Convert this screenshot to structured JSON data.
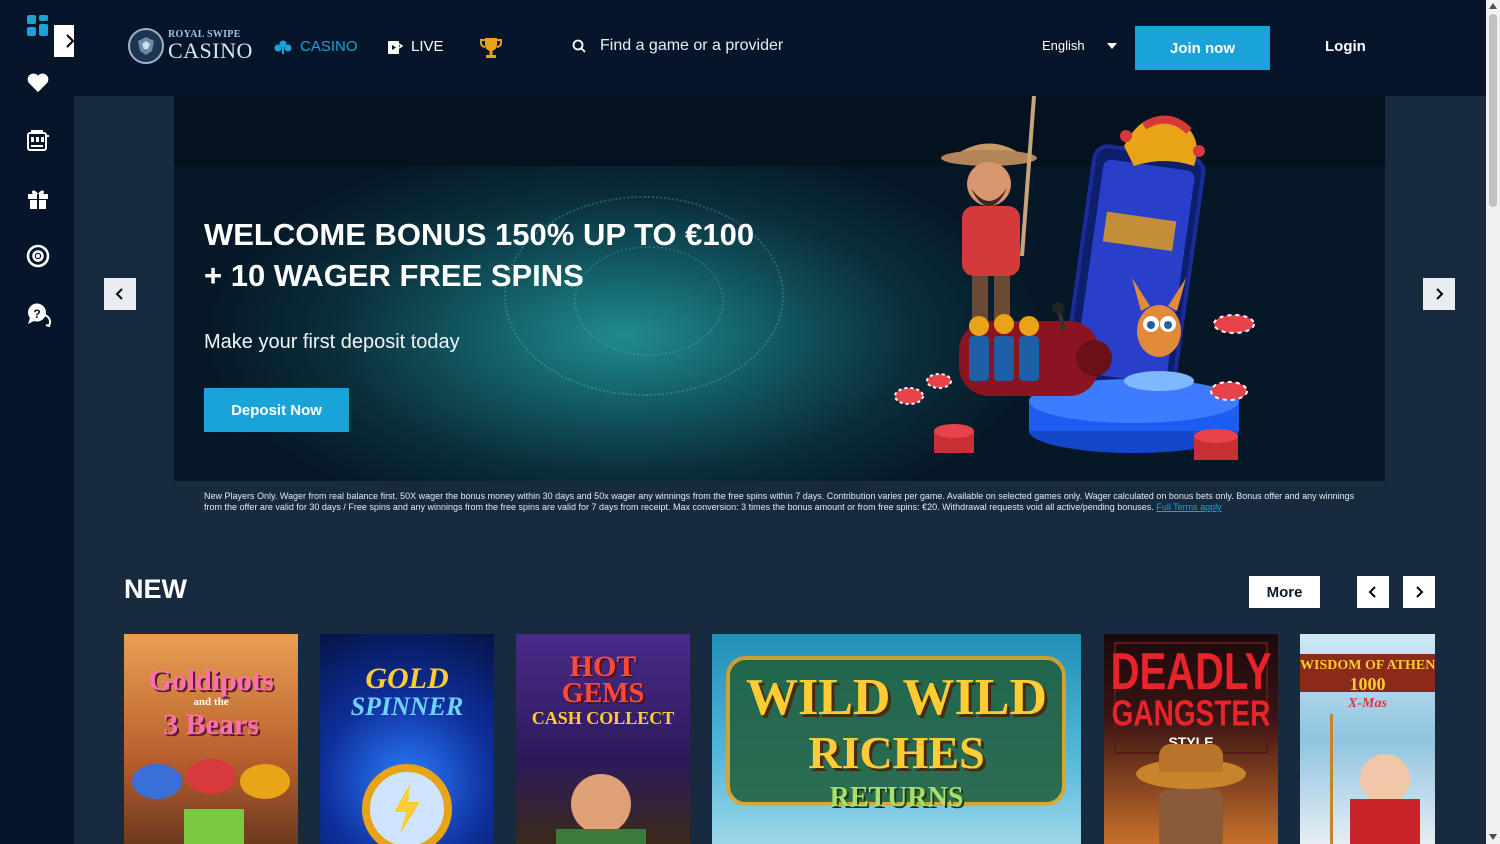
{
  "sidebar": {
    "expand_label": "expand sidebar",
    "items": [
      {
        "icon": "grid-icon",
        "label": "Menu"
      },
      {
        "icon": "heart-icon",
        "label": "Favourites"
      },
      {
        "icon": "slot-machine-icon",
        "label": "Casino"
      },
      {
        "icon": "gift-icon",
        "label": "Promotions"
      },
      {
        "icon": "lifebuoy-icon",
        "label": "Responsible gaming"
      },
      {
        "icon": "help-chat-icon",
        "label": "Help"
      }
    ]
  },
  "header": {
    "logo_small": "ROYAL SWIPE",
    "logo_big": "CASINO",
    "nav": [
      {
        "label": "CASINO",
        "icon": "clubs-icon",
        "active": true
      },
      {
        "label": "LIVE",
        "icon": "live-card-icon",
        "active": false
      },
      {
        "label": "",
        "icon": "trophy-icon",
        "active": false
      }
    ],
    "search_placeholder": "Find a game or a provider",
    "language": "English",
    "join_label": "Join now",
    "login_label": "Login"
  },
  "hero": {
    "title_line1": "WELCOME BONUS 150% UP TO €100",
    "title_line2": "+ 10 WAGER FREE SPINS",
    "subtitle": "Make your first deposit today",
    "cta_label": "Deposit Now",
    "terms_text": "New Players Only. Wager from real balance first. 50X wager the bonus money within 30 days and 50x wager any winnings from the free spins within 7 days. Contribution varies per game. Available on selected games only. Wager calculated on bonus bets only. Bonus offer and any winnings from the offer are valid for 30 days / Free spins and any winnings from the free spins are valid for 7 days from receipt. Max conversion: 3 times the bonus amount or from free spins: €20. Withdrawal requests void all active/pending bonuses.",
    "terms_link": "Full Terms apply"
  },
  "new_section": {
    "title": "NEW",
    "more_label": "More",
    "games": [
      {
        "line1": "Goldipots",
        "line2": "and the",
        "line3": "3 Bears"
      },
      {
        "line1": "GOLD",
        "line2": "SPINNER",
        "line3": ""
      },
      {
        "line1": "HOT",
        "line2": "GEMS",
        "line3": "CASH COLLECT"
      },
      {
        "line1": "WILD WILD",
        "line2": "RICHES",
        "line3": "RETURNS"
      },
      {
        "line1": "DEADLY",
        "line2": "GANGSTER",
        "line3": "STYLE"
      },
      {
        "line1": "WISDOM OF ATHENA",
        "line2": "1000",
        "line3": "X-Mas"
      }
    ]
  },
  "colors": {
    "accent": "#1aa3d6",
    "background": "#0b1a2e",
    "panel": "#172a3e"
  }
}
